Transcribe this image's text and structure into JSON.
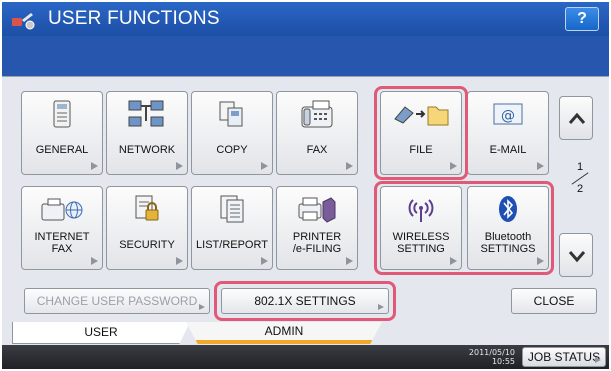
{
  "title": "USER FUNCTIONS",
  "help_label": "?",
  "buttons_row1": [
    {
      "label": "GENERAL",
      "icon": "general-icon"
    },
    {
      "label": "NETWORK",
      "icon": "network-icon"
    },
    {
      "label": "COPY",
      "icon": "copy-icon"
    },
    {
      "label": "FAX",
      "icon": "fax-icon"
    },
    {
      "label": "FILE",
      "icon": "file-icon"
    },
    {
      "label": "E-MAIL",
      "icon": "email-icon"
    }
  ],
  "buttons_row2": [
    {
      "label": "INTERNET\nFAX",
      "icon": "internet-fax-icon"
    },
    {
      "label": "SECURITY",
      "icon": "security-icon"
    },
    {
      "label": "LIST/REPORT",
      "icon": "list-report-icon"
    },
    {
      "label": "PRINTER\n/e-FILING",
      "icon": "printer-efiling-icon"
    },
    {
      "label": "WIRELESS\nSETTING",
      "icon": "wireless-icon"
    },
    {
      "label": "Bluetooth\nSETTINGS",
      "icon": "bluetooth-icon"
    }
  ],
  "pager": {
    "current": "1",
    "total": "2"
  },
  "change_password_label": "CHANGE USER PASSWORD",
  "dot1x_label": "802.1X SETTINGS",
  "close_label": "CLOSE",
  "tabs": {
    "user": "USER",
    "admin": "ADMIN"
  },
  "status": {
    "date": "2011/05/10",
    "time": "10:55",
    "job_status": "JOB STATUS"
  },
  "colors": {
    "title_bar": "#1d4fa6",
    "highlight": "#e05a78",
    "active_tab_accent": "#f2a92b"
  }
}
